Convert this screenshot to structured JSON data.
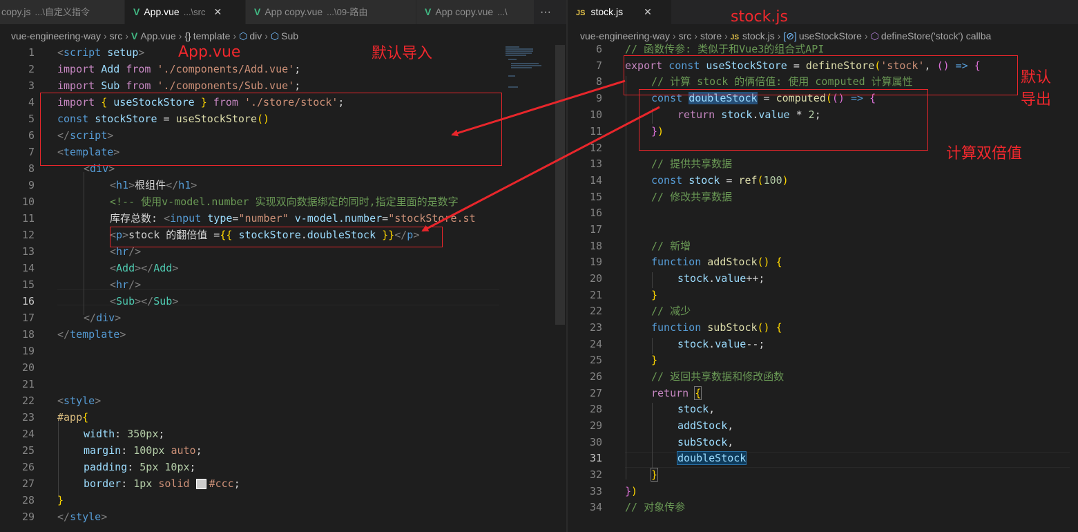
{
  "left_editor": {
    "tabs": [
      {
        "name": "copy.js",
        "desc": "...\\自定义指令",
        "icon": "js-icon",
        "active": false
      },
      {
        "name": "App.vue",
        "desc": "...\\src",
        "icon": "vue-icon",
        "active": true
      },
      {
        "name": "App copy.vue",
        "desc": "...\\09-路由",
        "icon": "vue-icon",
        "active": false
      },
      {
        "name": "App copy.vue",
        "desc": "...\\",
        "icon": "vue-icon",
        "active": false
      }
    ],
    "more_label": "···",
    "close_label": "✕",
    "breadcrumb": [
      "vue-engineering-way",
      "src",
      "App.vue",
      "template",
      "div",
      "Sub"
    ],
    "lines": [
      {
        "n": "1"
      },
      {
        "n": "2"
      },
      {
        "n": "3"
      },
      {
        "n": "4"
      },
      {
        "n": "5"
      },
      {
        "n": "6"
      },
      {
        "n": "7"
      },
      {
        "n": "8"
      },
      {
        "n": "9"
      },
      {
        "n": "10"
      },
      {
        "n": "11"
      },
      {
        "n": "12"
      },
      {
        "n": "13"
      },
      {
        "n": "14"
      },
      {
        "n": "15"
      },
      {
        "n": "16"
      },
      {
        "n": "17"
      },
      {
        "n": "18"
      },
      {
        "n": "19"
      },
      {
        "n": "20"
      },
      {
        "n": "21"
      },
      {
        "n": "22"
      },
      {
        "n": "23"
      },
      {
        "n": "24"
      },
      {
        "n": "25"
      },
      {
        "n": "26"
      },
      {
        "n": "27"
      },
      {
        "n": "28"
      },
      {
        "n": "29"
      }
    ],
    "current_line": "16"
  },
  "right_editor": {
    "tab": {
      "name": "stock.js",
      "icon": "js-icon",
      "active": true
    },
    "close_label": "✕",
    "breadcrumb": [
      "vue-engineering-way",
      "src",
      "store",
      "stock.js",
      "useStockStore",
      "defineStore('stock') callba"
    ],
    "current_line": "31"
  },
  "annotations": {
    "app_vue_label": "App.vue",
    "stock_js_label": "stock.js",
    "default_import": "默认导入",
    "default_export_1": "默认",
    "default_export_2": "导出",
    "compute_double": "计算双倍值"
  },
  "colors": {
    "annotation_red": "#e8262b",
    "vue_green": "#41b883",
    "js_yellow": "#e8c64a"
  }
}
